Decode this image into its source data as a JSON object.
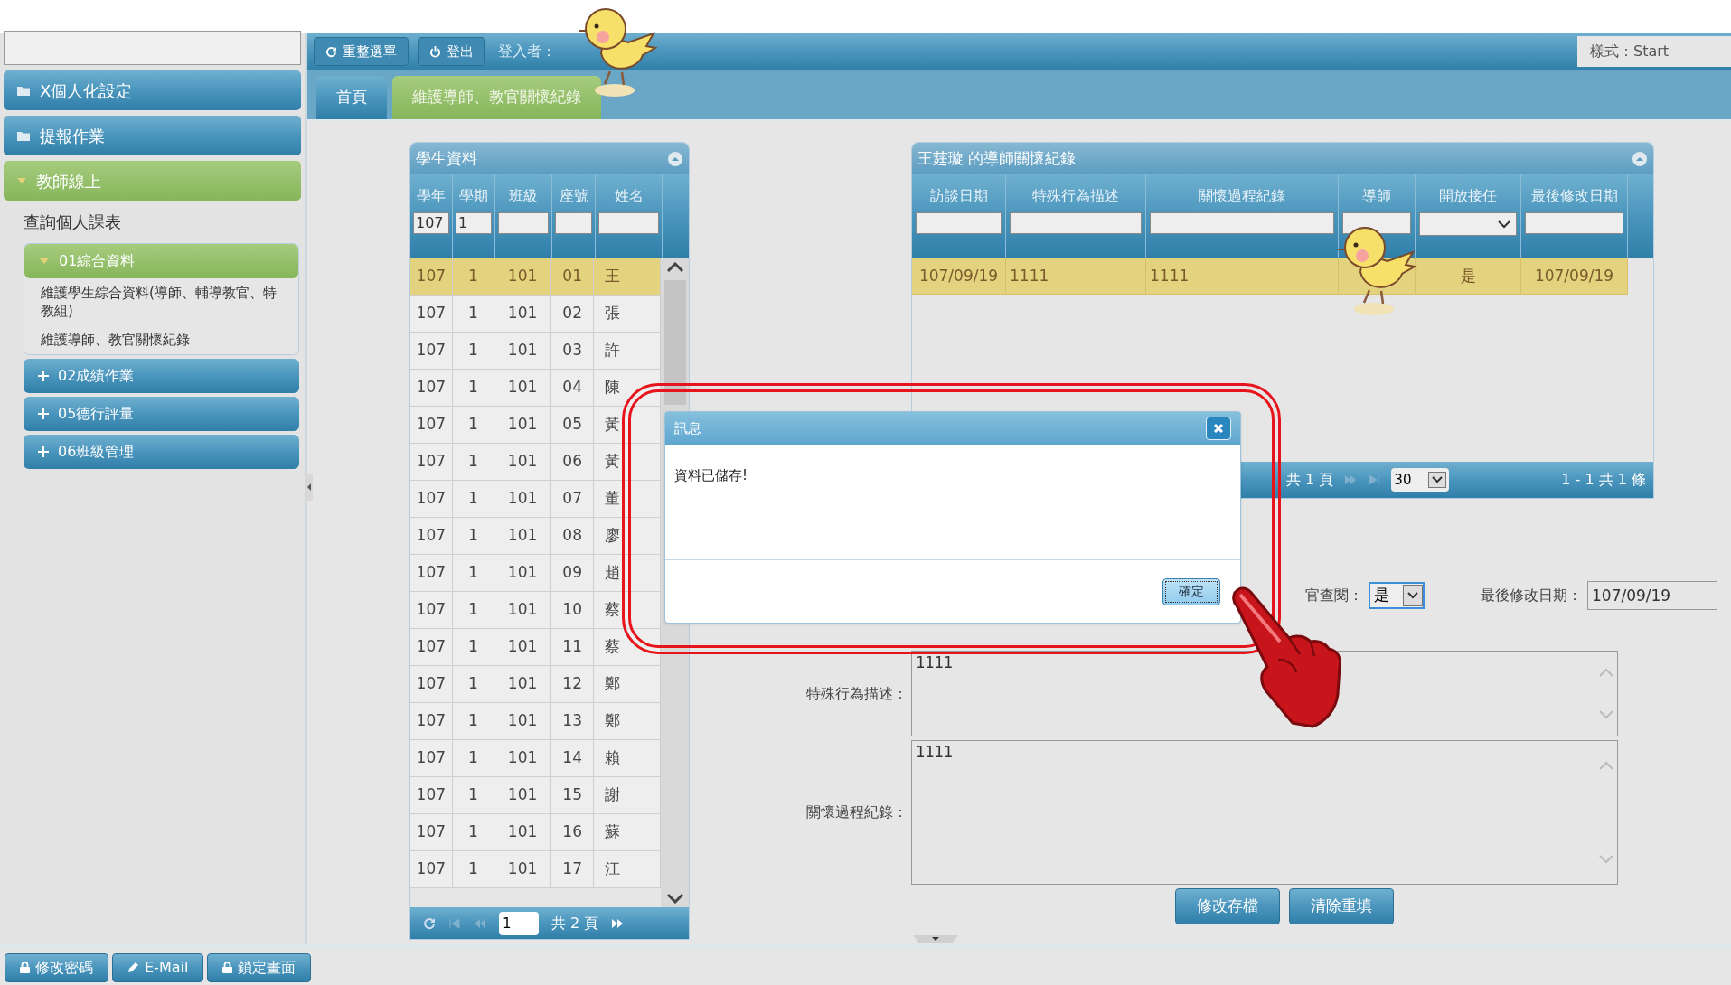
{
  "topbar": {
    "buttons": [
      {
        "label": "重整選單",
        "kind": "refresh"
      },
      {
        "label": "登出",
        "kind": "power"
      }
    ],
    "user_label": "登入者：",
    "style_label": "樣式：Start"
  },
  "sidebar": {
    "sections": [
      {
        "label": "X個人化設定",
        "expanded": false
      },
      {
        "label": "提報作業",
        "expanded": false
      },
      {
        "label": "教師線上",
        "expanded": true,
        "children": [
          {
            "label": "查詢個人課表",
            "kind": "link"
          },
          {
            "label": "01綜合資料",
            "kind": "group",
            "expanded": true,
            "children": [
              {
                "label": "維護學生綜合資料(導師、輔導教官、特教組)"
              },
              {
                "label": "維護導師、教官關懷紀錄"
              }
            ]
          },
          {
            "label": "02成績作業",
            "kind": "group",
            "expanded": false
          },
          {
            "label": "05德行評量",
            "kind": "group",
            "expanded": false
          },
          {
            "label": "06班級管理",
            "kind": "group",
            "expanded": false
          }
        ]
      }
    ]
  },
  "tabs": [
    {
      "label": "首頁",
      "selected": false
    },
    {
      "label": "維護導師、教官關懷紀錄",
      "selected": true
    }
  ],
  "students": {
    "title": "學生資料",
    "columns": [
      {
        "label": "學年",
        "filter": "107"
      },
      {
        "label": "學期",
        "filter": "1"
      },
      {
        "label": "班級"
      },
      {
        "label": "座號"
      },
      {
        "label": "姓名"
      }
    ],
    "rows": [
      {
        "cells": [
          "107",
          "1",
          "101",
          "01",
          "王"
        ],
        "selected": true
      },
      {
        "cells": [
          "107",
          "1",
          "101",
          "02",
          "張"
        ],
        "selected": false
      },
      {
        "cells": [
          "107",
          "1",
          "101",
          "03",
          "許"
        ],
        "selected": false
      },
      {
        "cells": [
          "107",
          "1",
          "101",
          "04",
          "陳"
        ],
        "selected": false
      },
      {
        "cells": [
          "107",
          "1",
          "101",
          "05",
          "黃"
        ],
        "selected": false
      },
      {
        "cells": [
          "107",
          "1",
          "101",
          "06",
          "黃"
        ],
        "selected": false
      },
      {
        "cells": [
          "107",
          "1",
          "101",
          "07",
          "董"
        ],
        "selected": false
      },
      {
        "cells": [
          "107",
          "1",
          "101",
          "08",
          "廖"
        ],
        "selected": false
      },
      {
        "cells": [
          "107",
          "1",
          "101",
          "09",
          "趙"
        ],
        "selected": false
      },
      {
        "cells": [
          "107",
          "1",
          "101",
          "10",
          "蔡"
        ],
        "selected": false
      },
      {
        "cells": [
          "107",
          "1",
          "101",
          "11",
          "蔡"
        ],
        "selected": false
      },
      {
        "cells": [
          "107",
          "1",
          "101",
          "12",
          "鄭"
        ],
        "selected": false
      },
      {
        "cells": [
          "107",
          "1",
          "101",
          "13",
          "鄭"
        ],
        "selected": false
      },
      {
        "cells": [
          "107",
          "1",
          "101",
          "14",
          "賴"
        ],
        "selected": false
      },
      {
        "cells": [
          "107",
          "1",
          "101",
          "15",
          "謝"
        ],
        "selected": false
      },
      {
        "cells": [
          "107",
          "1",
          "101",
          "16",
          "蘇"
        ],
        "selected": false
      },
      {
        "cells": [
          "107",
          "1",
          "101",
          "17",
          "江"
        ],
        "selected": false
      }
    ],
    "pager": {
      "page": "1",
      "total": "共 2 頁"
    }
  },
  "records": {
    "title": "王莛璇 的導師關懷紀錄",
    "columns": [
      "訪談日期",
      "特殊行為描述",
      "關懷過程紀錄",
      "導師",
      "開放接任",
      "最後修改日期"
    ],
    "rows": [
      {
        "date": "107/09/19",
        "behavior": "1111",
        "process": "1111",
        "open": "是",
        "modified": "107/09/19",
        "selected": true
      }
    ],
    "pager": {
      "total": "共 1 頁",
      "page_size": "30",
      "summary": "1 - 1 共 1 條"
    }
  },
  "form": {
    "review_label": "官查閱：",
    "review_value": "是",
    "modified_label": "最後修改日期：",
    "modified_value": "107/09/19",
    "behavior_label": "特殊行為描述：",
    "behavior_value": "1111",
    "process_label": "關懷過程紀錄：",
    "process_value": "1111",
    "buttons": [
      "修改存檔",
      "清除重填"
    ]
  },
  "dialog": {
    "title": "訊息",
    "message": "資料已儲存!",
    "button": "確定"
  },
  "footer": {
    "buttons": [
      {
        "label": "修改密碼",
        "kind": "lock"
      },
      {
        "label": "E-Mail",
        "kind": "pencil"
      },
      {
        "label": "鎖定畫面",
        "kind": "lock"
      }
    ]
  }
}
